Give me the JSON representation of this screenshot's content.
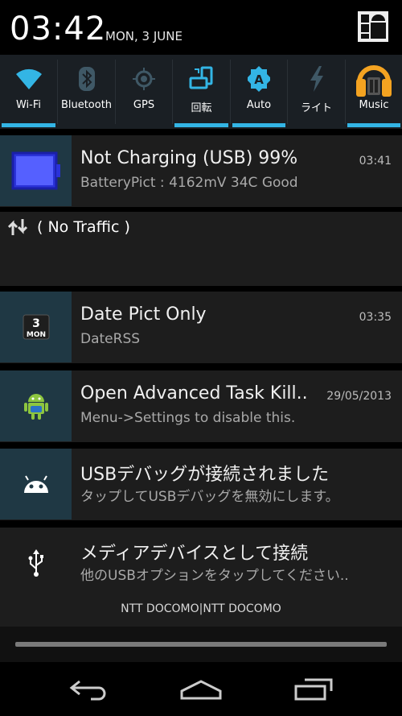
{
  "status": {
    "time": "03:42",
    "date": "MON, 3 JUNE"
  },
  "quick_settings": [
    {
      "label": "Wi-Fi",
      "icon": "wifi-icon",
      "active": true
    },
    {
      "label": "Bluetooth",
      "icon": "bluetooth-icon",
      "active": false
    },
    {
      "label": "GPS",
      "icon": "gps-icon",
      "active": false
    },
    {
      "label": "回転",
      "icon": "rotation-icon",
      "active": true
    },
    {
      "label": "Auto",
      "icon": "brightness-auto-icon",
      "active": true
    },
    {
      "label": "ライト",
      "icon": "flashlight-icon",
      "active": false
    },
    {
      "label": "Music",
      "icon": "music-headphones-icon",
      "active": true
    }
  ],
  "notifications": [
    {
      "title": "Not Charging (USB) 99%",
      "text": "BatteryPict : 4162mV 34C Good",
      "time": "03:41",
      "icon": "battery-icon"
    },
    {
      "title": "Date Pict Only",
      "text": "DateRSS",
      "time": "03:35",
      "icon": "calendar-date-icon",
      "icon_day": "3",
      "icon_weekday": "MON"
    },
    {
      "title": "Open Advanced Task Kill..",
      "text": "Menu->Settings to disable this.",
      "time": "29/05/2013",
      "icon": "android-robot-icon"
    },
    {
      "title": "USBデバッグが接続されました",
      "text": "タップしてUSBデバッグを無効にします。",
      "icon": "android-debug-icon"
    },
    {
      "title": "メディアデバイスとして接続",
      "text": "他のUSBオプションをタップしてください..",
      "icon": "usb-icon"
    }
  ],
  "traffic": {
    "text": "( No Traffic )",
    "icon": "data-arrows-icon"
  },
  "carrier": "NTT DOCOMO|NTT DOCOMO",
  "colors": {
    "accent": "#33b5e5",
    "notification_bg": "#1d1d1d",
    "icon_bg": "#1f3844",
    "qs_bg": "#1a1f24"
  },
  "navbar": {
    "back": "back-icon",
    "home": "home-icon",
    "recents": "recents-icon"
  }
}
